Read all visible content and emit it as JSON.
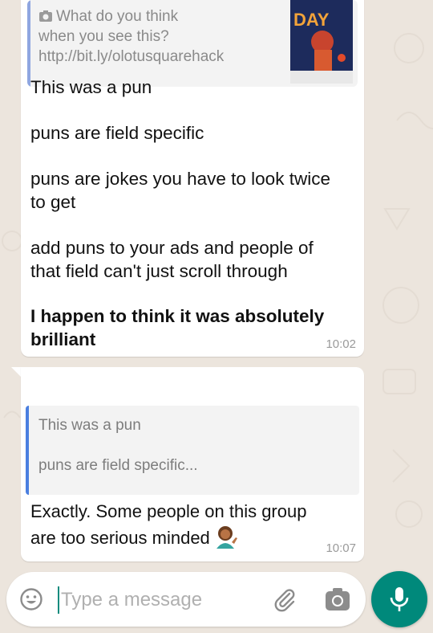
{
  "messages": [
    {
      "quote": {
        "icon": "camera-icon",
        "text_line1": "What do you think",
        "text_line2": "when you see this?",
        "text_line3": "http://bit.ly/olotusquarehack",
        "thumb_text": "DAY"
      },
      "paragraphs": [
        "This was a pun",
        "puns are field specific",
        "puns are jokes you have to look twice",
        "to get",
        "add puns to your ads and people of",
        "that field can't just scroll through"
      ],
      "bold_line1": "I happen to think it was absolutely",
      "bold_line2": "brilliant",
      "time": "10:02"
    },
    {
      "quote": {
        "line1": "This was a pun",
        "line2": "puns are field specific..."
      },
      "text_line1": "Exactly. Some people on this group",
      "text_line2": "are too serious minded",
      "emoji": "person-tipping-hand-emoji",
      "time": "10:07"
    }
  ],
  "input": {
    "placeholder": "Type a message",
    "emoji_icon": "smiley-icon",
    "attach_icon": "paperclip-icon",
    "camera_icon": "camera-icon",
    "send_icon": "mic-icon"
  },
  "colors": {
    "background": "#ece5dd",
    "accent": "#00897b",
    "quote_bar_1": "#8fa6e0",
    "quote_bar_2": "#4a7fe0"
  }
}
